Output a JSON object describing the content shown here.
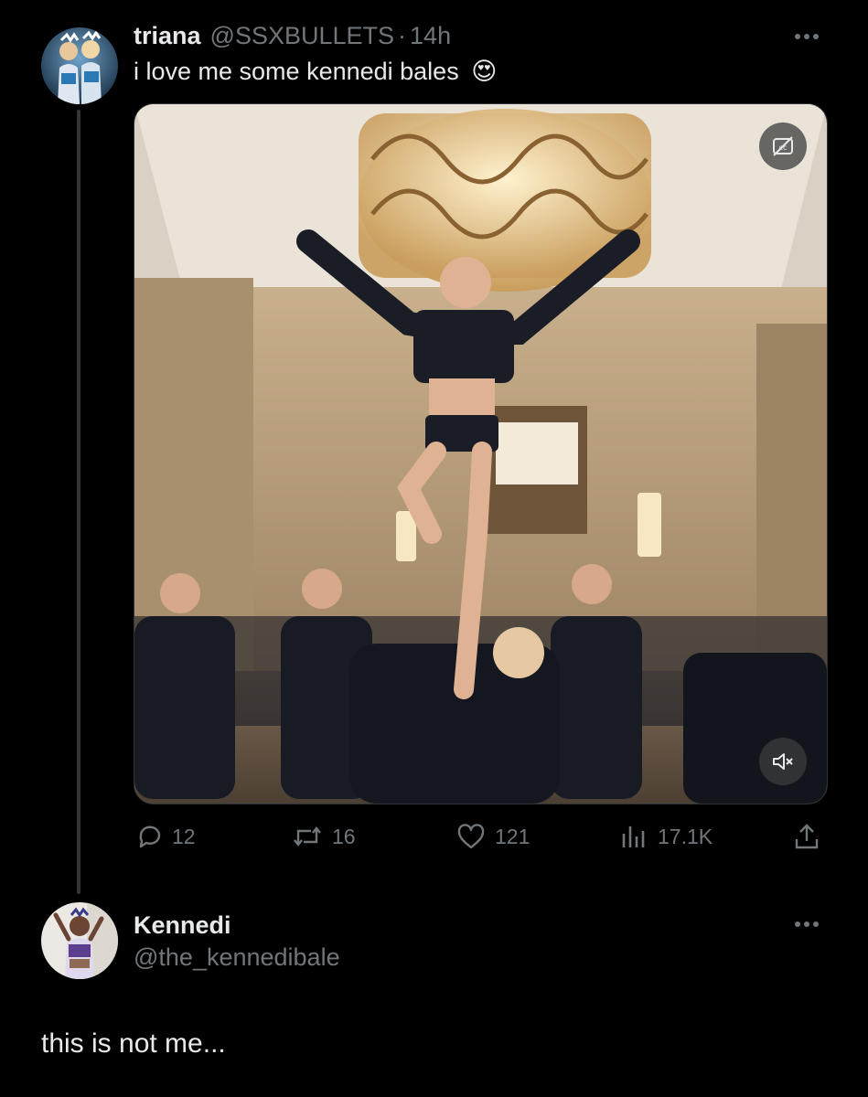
{
  "tweet": {
    "author_name": "triana",
    "author_handle": "@SSXBULLETS",
    "separator": "·",
    "time": "14h",
    "text": "i love me some kennedi bales",
    "emoji": "😍",
    "more_icon": "more-horizontal-icon",
    "media": {
      "type": "video",
      "caption_badge_icon": "captions-off-icon",
      "mute_badge_icon": "volume-muted-icon"
    },
    "actions": {
      "replies": "12",
      "retweets": "16",
      "likes": "121",
      "views": "17.1K"
    }
  },
  "reply": {
    "author_name": "Kennedi",
    "author_handle": "@the_kennedibale",
    "text": "this is not me..."
  },
  "colors": {
    "background": "#000000",
    "text": "#e7e9ea",
    "muted": "#71767b",
    "divider": "#333639"
  }
}
